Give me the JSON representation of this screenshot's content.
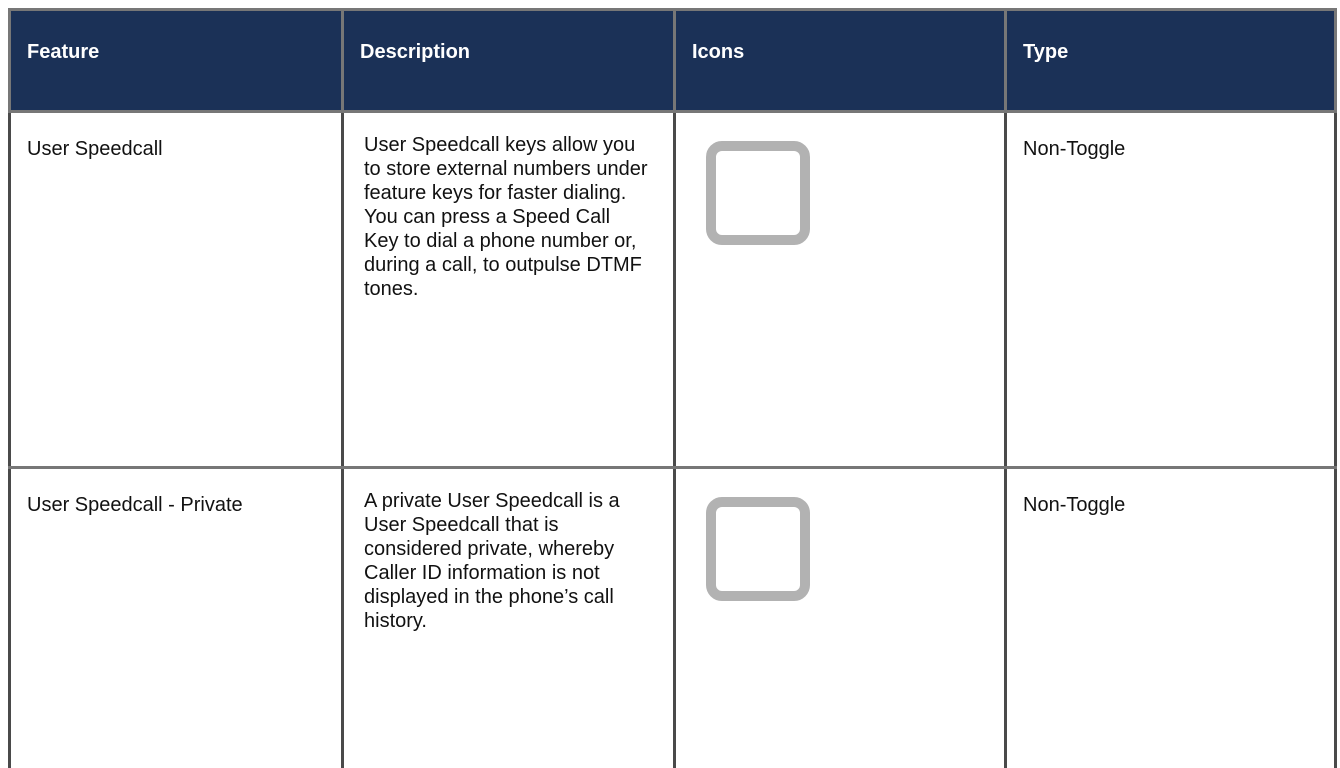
{
  "table": {
    "headers": [
      "Feature",
      "Description",
      "Icons",
      "Type"
    ],
    "rows": [
      {
        "feature": "User Speedcall",
        "description": "User Speedcall keys allow you to store external numbers under feature keys for faster dialing. You can press a Speed Call Key to dial a phone number or, during a call, to outpulse DTMF tones.",
        "icon": "blank-key-icon",
        "type": "Non-Toggle"
      },
      {
        "feature": "User Speedcall - Private",
        "description": "A private User Speedcall is a User Speedcall that is considered private, whereby Caller ID information is not displayed in the phone’s call history.",
        "icon": "blank-key-icon",
        "type": "Non-Toggle"
      }
    ]
  },
  "colors": {
    "header_background": "#1b3157",
    "header_text": "#ffffff",
    "border": "#777777",
    "icon_border": "#b2b2b2"
  }
}
